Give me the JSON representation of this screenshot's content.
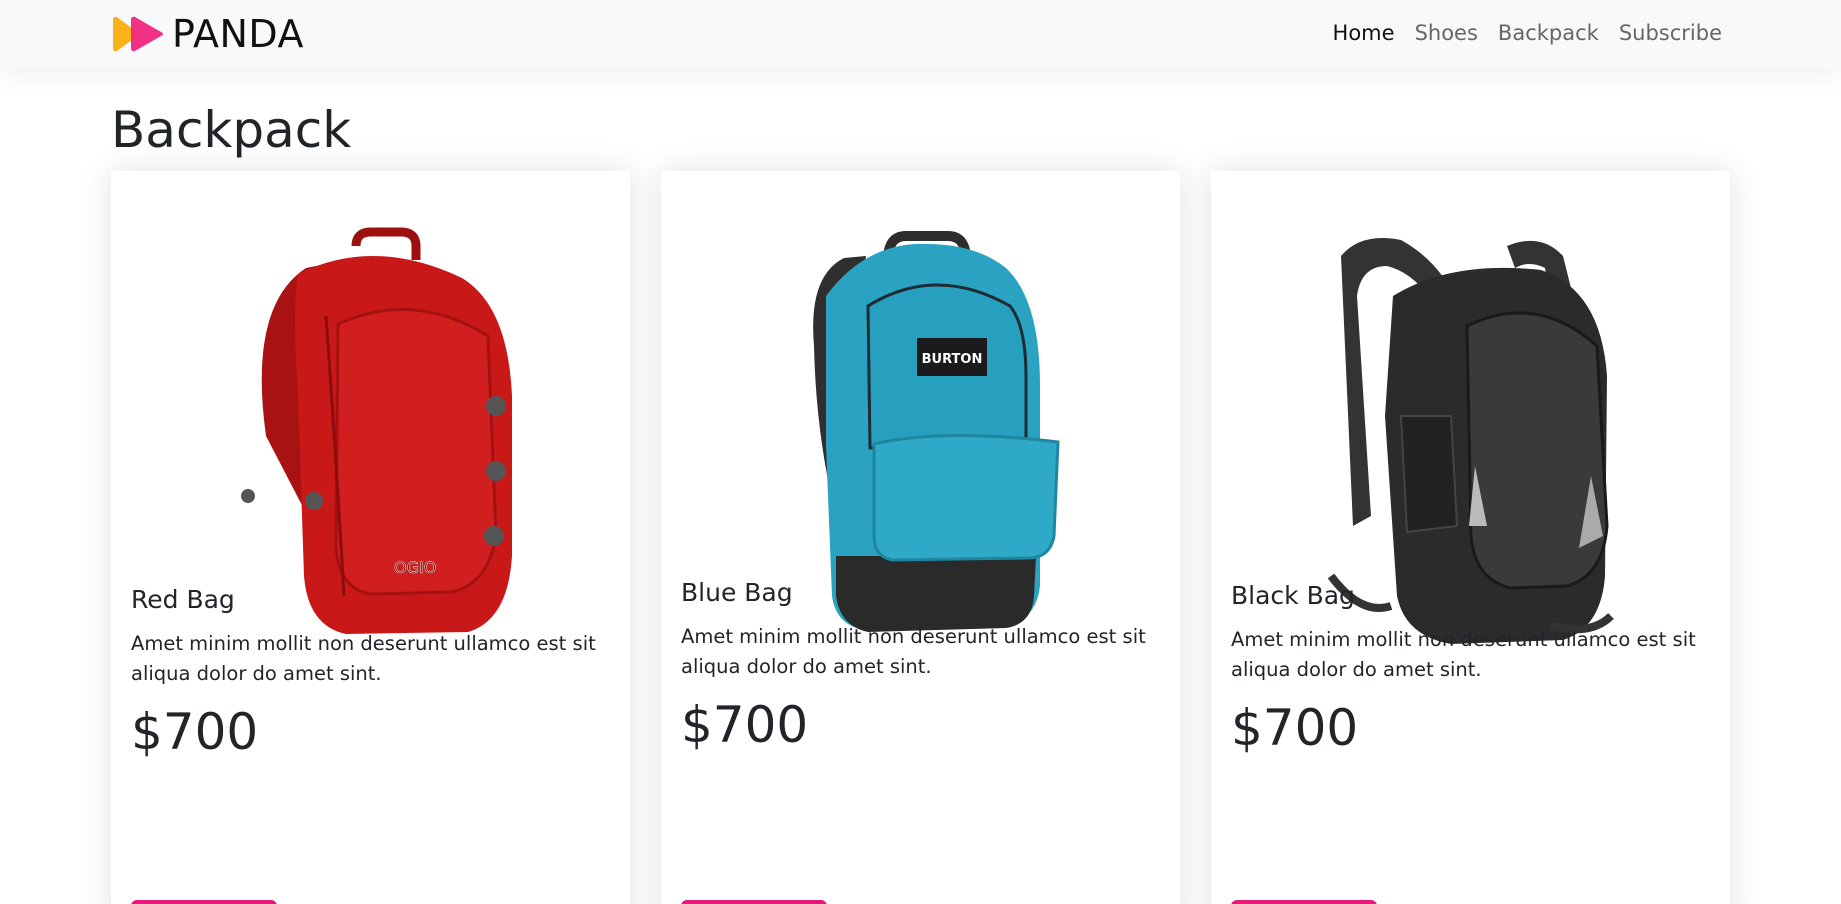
{
  "brand": {
    "name": "PANDA"
  },
  "nav": {
    "links": [
      {
        "label": "Home",
        "active": true
      },
      {
        "label": "Shoes",
        "active": false
      },
      {
        "label": "Backpack",
        "active": false
      },
      {
        "label": "Subscribe",
        "active": false
      }
    ]
  },
  "page": {
    "title": "Backpack"
  },
  "products": [
    {
      "name": "Red Bag",
      "description": "Amet minim mollit non deserunt ullamco est sit aliqua dolor do amet sint.",
      "price": "$700",
      "color": "#c81818"
    },
    {
      "name": "Blue Bag",
      "description": "Amet minim mollit non deserunt ullamco est sit aliqua dolor do amet sint.",
      "price": "$700",
      "color": "#2aa3c2",
      "logo_text": "BURTON"
    },
    {
      "name": "Black Bag",
      "description": "Amet minim mollit non deserunt ullamco est sit aliqua dolor do amet sint.",
      "price": "$700",
      "color": "#2b2b2b"
    }
  ],
  "colors": {
    "accent": "#e5197a",
    "logo_yellow": "#f9b21a",
    "logo_pink": "#f0267f"
  }
}
